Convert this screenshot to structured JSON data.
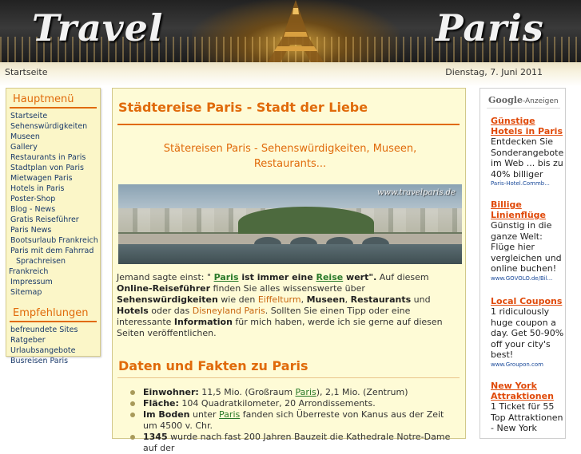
{
  "header": {
    "logo_left": "Travel",
    "logo_right": "Paris"
  },
  "topbar": {
    "home": "Startseite",
    "date": "Dienstag, 7. Juni 2011"
  },
  "sidebar": {
    "main_title": "Hauptmenü",
    "main_items": [
      "Startseite",
      "Sehenswürdigkeiten",
      "Museen",
      "Gallery",
      "Restaurants in Paris",
      "Stadtplan von Paris",
      "Mietwagen Paris",
      "Hotels in Paris",
      "Poster-Shop",
      "Blog - News",
      "Gratis Reiseführer",
      "Paris News",
      "Bootsurlaub Frankreich",
      "Paris mit dem Fahrrad"
    ],
    "wrap_item_1": "Sprachreisen",
    "wrap_item_2": "Frankreich",
    "main_items_tail": [
      "Impressum",
      "Sitemap"
    ],
    "rec_title": "Empfehlungen",
    "rec_items": [
      "befreundete Sites",
      "Ratgeber",
      "Urlaubsangebote",
      "Busreisen Paris"
    ]
  },
  "content": {
    "title": "Städtereise Paris - Stadt der Liebe",
    "subtitle": "Stätereisen Paris - Sehenswürdigkeiten, Museen, Restaurants...",
    "photo_watermark": "www.travelparis.de",
    "para": {
      "p1": "Jemand sagte einst: \" ",
      "paris": "Paris",
      "p2": " ist immer eine ",
      "reise": "Reise",
      "p3": " wert\".",
      "p4": " Auf diesem ",
      "online": "Online-Reiseführer",
      "p5": " finden Sie alles wissenswerte über ",
      "sehens": "Sehenswürdigkeiten",
      "p6": " wie den ",
      "eiffel": "Eiffelturm",
      "p7": ", ",
      "museen": "Museen",
      "p8": ", ",
      "restaurants": "Restaurants",
      "p9": " und ",
      "hotels": "Hotels",
      "p10": " oder das ",
      "disney": "Disneyland Paris",
      "p11": ". Sollten Sie einen Tipp oder eine interessante ",
      "information": "Information",
      "p12": " für mich haben, werde ich  sie gerne auf diesen Seiten veröffentlichen."
    },
    "facts_title": "Daten und Fakten zu Paris",
    "facts": [
      {
        "label": "Einwohner:",
        "pre": " 11,5 Mio. (Großraum ",
        "link": "Paris",
        "post": "), 2,1 Mio. (Zentrum)"
      },
      {
        "label": "Fläche:",
        "pre": " 104 Quadratkilometer, 20 Arrondissements.",
        "link": "",
        "post": ""
      },
      {
        "label": "Im Boden",
        "pre": " unter ",
        "link": "Paris",
        "post": " fanden sich Überreste von Kanus aus der Zeit um 4500 v. Chr."
      },
      {
        "label": "1345",
        "pre": " wurde nach fast 200 Jahren Bauzeit die Kathedrale Notre-Dame auf der",
        "link": "",
        "post": ""
      }
    ]
  },
  "ads": {
    "google": "Google",
    "label": "-Anzeigen",
    "items": [
      {
        "title": "Günstige Hotels in Paris",
        "desc": "Entdecken Sie Sonderangebote im Web ... bis zu 40% billiger",
        "url": "Paris-Hotel.Commb..."
      },
      {
        "title": "Billige Linienflüge",
        "desc": "Günstig in die ganze Welt: Flüge hier vergleichen und online buchen!",
        "url": "www.GOVOLO.de/Bil..."
      },
      {
        "title": "Local Coupons",
        "desc": "1 ridiculously huge coupon a day. Get 50-90% off your city's best!",
        "url": "www.Groupon.com"
      },
      {
        "title": "New York Attraktionen",
        "desc": "1 Ticket für 55 Top Attraktionen - New York",
        "url": ""
      }
    ]
  }
}
